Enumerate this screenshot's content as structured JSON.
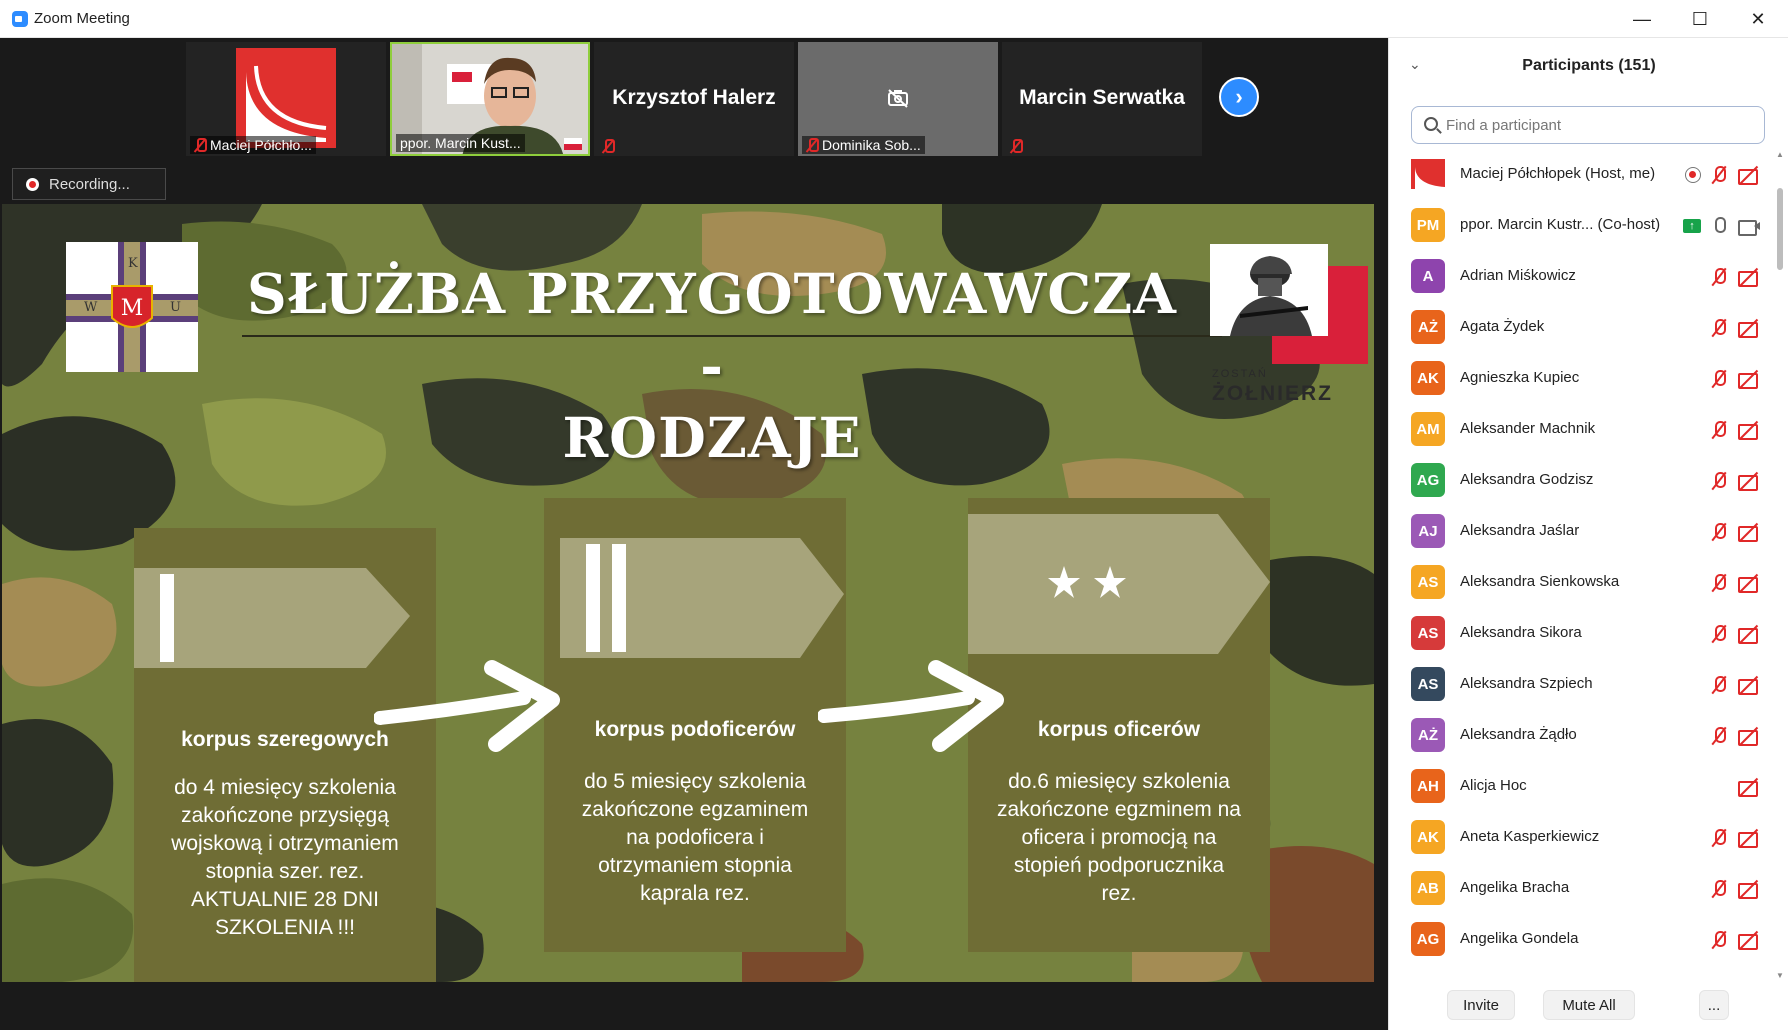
{
  "window": {
    "title": "Zoom Meeting",
    "minimize": "—",
    "maximize": "☐",
    "close": "✕"
  },
  "video_strip": {
    "tiles": [
      {
        "name": "Maciej Półchło..."
      },
      {
        "name": "ppor. Marcin Kust..."
      },
      {
        "name": "Krzysztof Halerz"
      },
      {
        "name": "Dominika Sob..."
      },
      {
        "name": "Marcin Serwatka"
      }
    ],
    "next": "›"
  },
  "recording": {
    "label": "Recording..."
  },
  "slide": {
    "title_line1": "SŁUŻBA PRZYGOTOWAWCZA -",
    "title_line2": "RODZAJE",
    "crest_letters": {
      "top": "K",
      "left": "W",
      "right": "U"
    },
    "logo_text1": "ZOSTAŃ",
    "logo_text2": "ŻOŁNIERZ",
    "panels": [
      {
        "heading": "korpus szeregowych",
        "lines": [
          "do 4 miesięcy szkolenia",
          "zakończone przysięgą",
          "wojskową i otrzymaniem",
          "stopnia szer. rez.",
          "AKTUALNIE 28 DNI",
          "SZKOLENIA !!!"
        ]
      },
      {
        "heading": "korpus podoficerów",
        "lines": [
          "do 5 miesięcy szkolenia",
          "zakończone egzaminem",
          "na podoficera i",
          "otrzymaniem stopnia",
          "kaprala rez."
        ]
      },
      {
        "heading": "korpus oficerów",
        "lines": [
          "do.6 miesięcy szkolenia",
          "zakończone egzminem na",
          "oficera i promocją na",
          "stopień podporucznika",
          "rez."
        ]
      }
    ]
  },
  "participants": {
    "title": "Participants (151)",
    "collapse": "⌄",
    "search_placeholder": "Find a participant",
    "list": [
      {
        "initials": "",
        "name": "Maciej Półchłopek (Host, me)",
        "color": "#e0302e",
        "status": [
          "rec",
          "mic-off",
          "vid-off"
        ]
      },
      {
        "initials": "PM",
        "name": "ppor. Marcin Kustr...  (Co-host)",
        "color": "#f5a623",
        "status": [
          "share",
          "mic-on",
          "vid-on"
        ]
      },
      {
        "initials": "A",
        "name": "Adrian Miśkowicz",
        "color": "#8e44ad",
        "status": [
          "mic-off",
          "vid-off"
        ]
      },
      {
        "initials": "AŻ",
        "name": "Agata Żydek",
        "color": "#e8641b",
        "status": [
          "mic-off",
          "vid-off"
        ]
      },
      {
        "initials": "AK",
        "name": "Agnieszka Kupiec",
        "color": "#e8641b",
        "status": [
          "mic-off",
          "vid-off"
        ]
      },
      {
        "initials": "AM",
        "name": "Aleksander Machnik",
        "color": "#f5a623",
        "status": [
          "mic-off",
          "vid-off"
        ]
      },
      {
        "initials": "AG",
        "name": "Aleksandra Godzisz",
        "color": "#2fa84f",
        "status": [
          "mic-off",
          "vid-off"
        ]
      },
      {
        "initials": "AJ",
        "name": "Aleksandra Jaślar",
        "color": "#9b59b6",
        "status": [
          "mic-off",
          "vid-off"
        ]
      },
      {
        "initials": "AS",
        "name": "Aleksandra Sienkowska",
        "color": "#f5a623",
        "status": [
          "mic-off",
          "vid-off"
        ]
      },
      {
        "initials": "AS",
        "name": "Aleksandra Sikora",
        "color": "#d63a3a",
        "status": [
          "mic-off",
          "vid-off"
        ]
      },
      {
        "initials": "AS",
        "name": "Aleksandra Szpiech",
        "color": "#34495e",
        "status": [
          "mic-off",
          "vid-off"
        ]
      },
      {
        "initials": "AŻ",
        "name": "Aleksandra Żądło",
        "color": "#9b59b6",
        "status": [
          "mic-off",
          "vid-off"
        ]
      },
      {
        "initials": "AH",
        "name": "Alicja Hoc",
        "color": "#e8641b",
        "status": [
          "vid-off-only"
        ]
      },
      {
        "initials": "AK",
        "name": "Aneta Kasperkiewicz",
        "color": "#f5a623",
        "status": [
          "mic-off",
          "vid-off"
        ]
      },
      {
        "initials": "AB",
        "name": "Angelika Bracha",
        "color": "#f5a623",
        "status": [
          "mic-off",
          "vid-off"
        ]
      },
      {
        "initials": "AG",
        "name": "Angelika Gondela",
        "color": "#e8641b",
        "status": [
          "mic-off",
          "vid-off"
        ]
      }
    ],
    "footer": {
      "invite": "Invite",
      "mute_all": "Mute All",
      "more": "..."
    }
  }
}
